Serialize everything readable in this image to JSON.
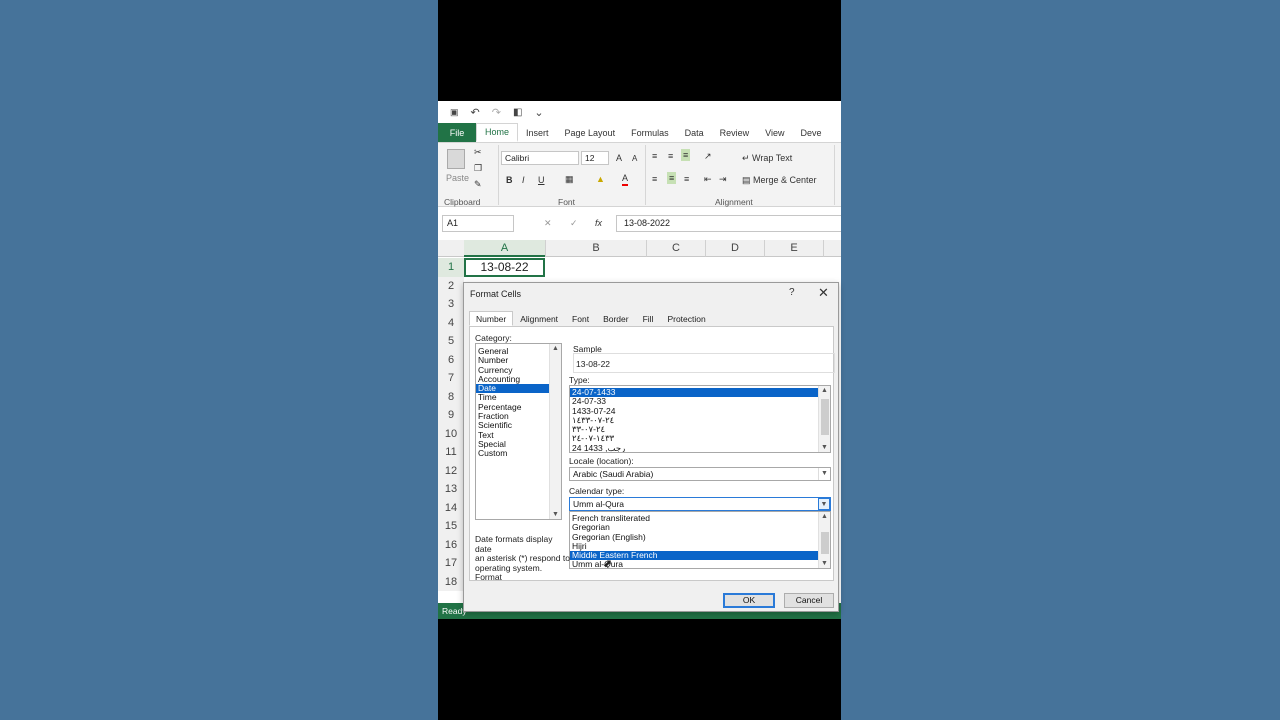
{
  "qat": {
    "save_icon": "save-icon",
    "undo_icon": "undo-icon",
    "redo_icon": "redo-icon",
    "preview_icon": "print-preview-icon",
    "more_icon": "customize-icon",
    "undo_glyph": "↶",
    "redo_glyph": "↷",
    "save_glyph": "💾",
    "preview_glyph": "🔍",
    "more_glyph": "⌄"
  },
  "ribbon_tabs": [
    "File",
    "Home",
    "Insert",
    "Page Layout",
    "Formulas",
    "Data",
    "Review",
    "View",
    "Deve"
  ],
  "ribbon": {
    "paste_label": "Paste",
    "clipboard_label": "Clipboard",
    "font_name": "Calibri",
    "font_size": "12",
    "font_label": "Font",
    "bold": "B",
    "italic": "I",
    "underline": "U",
    "grow_font": "A",
    "shrink_font": "A",
    "font_color_glyph": "A",
    "wrap_text": "Wrap Text",
    "merge_center": "Merge & Center",
    "alignment_label": "Alignment"
  },
  "formula_bar": {
    "name_box": "A1",
    "fx_label": "fx",
    "value": "13-08-2022"
  },
  "columns": [
    "A",
    "B",
    "C",
    "D",
    "E"
  ],
  "rows": [
    "1",
    "2",
    "3",
    "4",
    "5",
    "6",
    "7",
    "8",
    "9",
    "10",
    "11",
    "12",
    "13",
    "14",
    "15",
    "16",
    "17",
    "18"
  ],
  "cell_a1": "13-08-22",
  "status": "Ready",
  "dialog": {
    "title": "Format Cells",
    "help": "?",
    "close": "✕",
    "tabs": [
      "Number",
      "Alignment",
      "Font",
      "Border",
      "Fill",
      "Protection"
    ],
    "category_label": "Category:",
    "categories": [
      "General",
      "Number",
      "Currency",
      "Accounting",
      "Date",
      "Time",
      "Percentage",
      "Fraction",
      "Scientific",
      "Text",
      "Special",
      "Custom"
    ],
    "selected_category": "Date",
    "sample_label": "Sample",
    "sample_value": "13-08-22",
    "type_label": "Type:",
    "types": [
      "24-07-1433",
      "24-07-33",
      "1433-07-24",
      "٢٤-٠٧-١٤٣٣",
      "٢٤-٠٧-٣٣",
      "١٤٣٣-٠٧-٢٤",
      "24 رجب, 1433"
    ],
    "selected_type": "24-07-1433",
    "locale_label": "Locale (location):",
    "locale_value": "Arabic (Saudi Arabia)",
    "calendar_label": "Calendar type:",
    "calendar_value": "Umm al-Qura",
    "calendar_options": [
      "French transliterated",
      "Gregorian",
      "Gregorian (English)",
      "Hijri",
      "Middle Eastern French",
      "Umm al-Qura"
    ],
    "highlighted_option": "Middle Eastern French",
    "description_lines": [
      "Date formats display date",
      "an asterisk (*) respond to",
      "operating system. Format"
    ],
    "ok": "OK",
    "cancel": "Cancel"
  }
}
